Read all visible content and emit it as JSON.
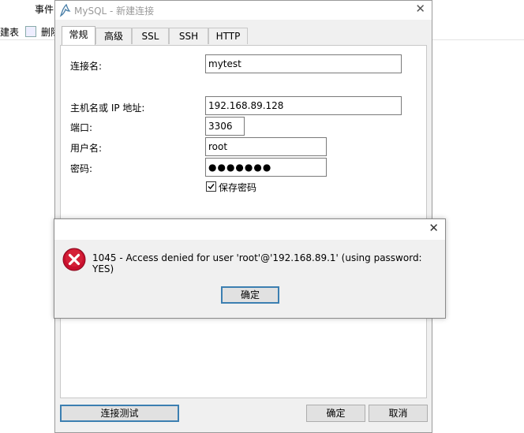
{
  "background": {
    "menu_text": "事件",
    "toolbar_left": "建表",
    "toolbar_right": "删除"
  },
  "dialog": {
    "title": "MySQL - 新建连接",
    "tabs": [
      "常规",
      "高级",
      "SSL",
      "SSH",
      "HTTP"
    ],
    "fields": {
      "connection_name_label": "连接名:",
      "connection_name": "mytest",
      "host_label": "主机名或 IP 地址:",
      "host": "192.168.89.128",
      "port_label": "端口:",
      "port": "3306",
      "user_label": "用户名:",
      "user": "root",
      "password_label": "密码:",
      "password": "●●●●●●●",
      "save_password_label": "保存密码"
    },
    "buttons": {
      "test": "连接测试",
      "ok": "确定",
      "cancel": "取消"
    }
  },
  "error_dialog": {
    "message": "1045 - Access denied for user 'root'@'192.168.89.1' (using password: YES)",
    "ok": "确定"
  }
}
